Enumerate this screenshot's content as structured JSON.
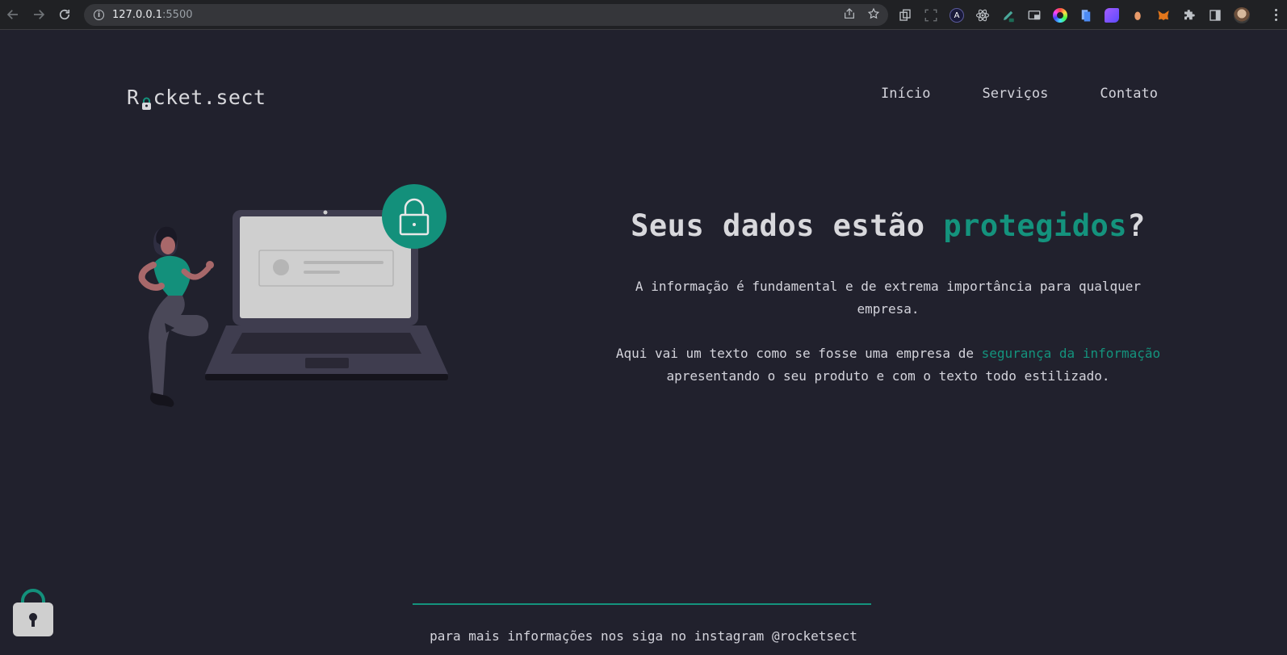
{
  "browser": {
    "url_host": "127.0.0.1",
    "url_port": ":5500",
    "extensions": [
      "copy-icon",
      "screenshot-icon",
      "a-extension-icon",
      "react-devtools-icon",
      "pen-extension-icon",
      "cast-icon",
      "color-picker-icon",
      "document-icon",
      "paint-icon",
      "sticker-icon",
      "metamask-icon",
      "puzzle-icon",
      "sidepanel-icon"
    ]
  },
  "header": {
    "logo_before": "R",
    "logo_after": "cket.sect",
    "nav": [
      "Início",
      "Serviços",
      "Contato"
    ]
  },
  "hero": {
    "title_before": "Seus dados estão ",
    "title_accent": "protegidos",
    "title_after": "?",
    "paragraph1": "A informação é fundamental e de extrema importância para qualquer empresa.",
    "paragraph2_before": "Aqui vai um texto como se fosse uma empresa de ",
    "paragraph2_accent": "segurança da informação",
    "paragraph2_after": " apresentando o seu produto e com o texto todo estilizado."
  },
  "footer": {
    "text": "para mais informações nos siga no instagram @rocketsect"
  },
  "colors": {
    "background": "#21212d",
    "accent": "#14937d",
    "text": "#d4d4dc"
  }
}
